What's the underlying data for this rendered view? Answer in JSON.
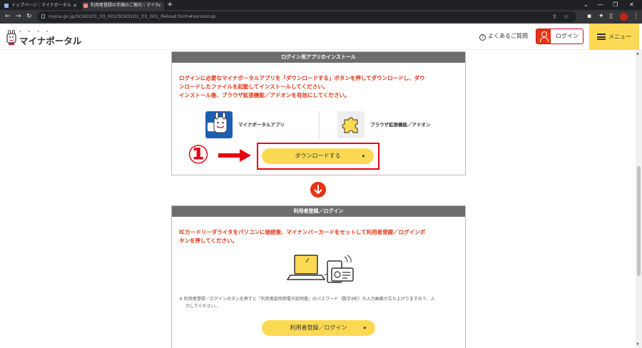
{
  "browser": {
    "tabs": [
      {
        "label": "トップページ｜マイナポータル",
        "active": false
      },
      {
        "label": "利用者登録の手順のご案内｜マイナ",
        "active": true
      }
    ],
    "url": "myna.go.jp/SCK0101_03_001/SCK0101_03_001_Reload.form#versionup"
  },
  "site": {
    "logo_dots": "• • • •",
    "logo_text": "マイナポータル",
    "faq_label": "よくあるご質問",
    "login_label": "ログイン",
    "menu_label": "メニュー"
  },
  "install_panel": {
    "title": "ログイン用アプリのインストール",
    "warning_lines": [
      "ログインに必要なマイナポータルアプリを「ダウンロードする」ボタンを押してダウンロードし、ダウ",
      "ンロードしたファイルを起動してインストールしてください。",
      "インストール後、ブラウザ拡張機能／アドオンを有効にしてください。"
    ],
    "app_label": "マイナポータルアプリ",
    "addon_label": "ブラウザ拡張機能／アドオン",
    "download_label": "ダウンロードする",
    "button_arrow": "▶"
  },
  "annotation": {
    "step_number": "①",
    "highlight_color": "#e60012"
  },
  "register_panel": {
    "title": "利用者登録／ログイン",
    "warning_lines": [
      "ICカードリーダライタをパソコンに接続後、マイナンバーカードをセットして利用者登録／ログインボ",
      "タンを押してください。"
    ],
    "note_lines": [
      "※ 利用者登録／ログインボタンを押すと「利用者証明用電子証明書」のパスワード（数字4桁）の入力画面が立ち上がりますので、入",
      "力してください。"
    ],
    "button_label": "利用者登録／ログイン",
    "button_arrow": "▶"
  },
  "colors": {
    "accent_yellow": "#fbd952",
    "warning_red": "#e63312",
    "panel_header": "#6d6d6d"
  }
}
